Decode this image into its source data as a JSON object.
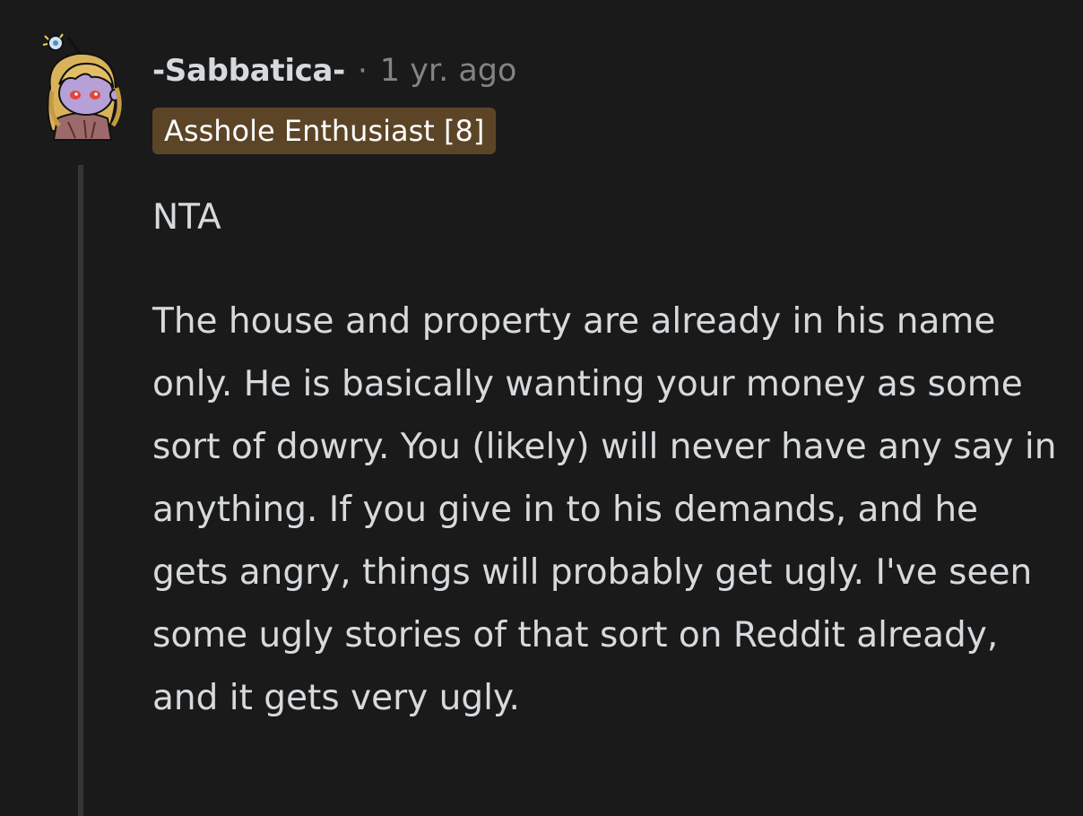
{
  "comment": {
    "author": "-Sabbatica-",
    "separator": "·",
    "timestamp": "1 yr. ago",
    "flair": "Asshole Enthusiast [8]",
    "avatar_icon": "snoo-avatar-icon",
    "colors": {
      "background": "#1a1a1b",
      "text": "#d7dadc",
      "muted": "#818384",
      "flair_bg": "#5c4527",
      "thread_line": "#343536"
    },
    "paragraphs": [
      "NTA",
      "The house and property are already in his name only. He is basically wanting your money as some sort of dowry. You (likely) will never have any say in anything. If you give in to his demands, and he gets angry, things will probably get ugly. I've seen some ugly stories of that sort on Reddit already, and it gets very ugly."
    ]
  }
}
